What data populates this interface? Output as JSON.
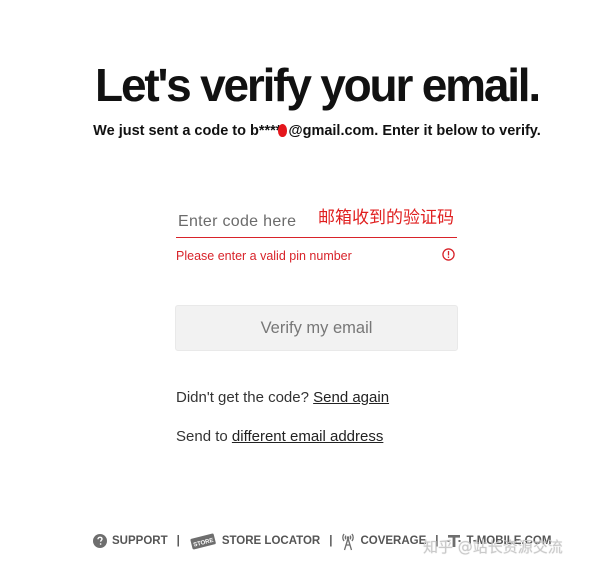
{
  "header": {
    "title": "Let's verify your email.",
    "subtitle_before": "We just sent a code to b****",
    "subtitle_after": "@gmail.com. Enter it below to verify."
  },
  "code_input": {
    "placeholder": "Enter code here",
    "value": "",
    "annotation": "邮箱收到的验证码"
  },
  "error": {
    "message": "Please enter a valid pin number",
    "icon": "exclamation-circle-icon",
    "color": "#d8232a"
  },
  "verify_button": {
    "label": "Verify my email"
  },
  "resend": {
    "prompt": "Didn't get the code?",
    "link": "Send again"
  },
  "change_email": {
    "prompt": "Send to",
    "link": "different email address"
  },
  "footer": {
    "items": [
      {
        "label": "SUPPORT",
        "icon": "question-circle-icon"
      },
      {
        "label": "STORE LOCATOR",
        "icon": "store-icon",
        "badge": "STORE"
      },
      {
        "label": "COVERAGE",
        "icon": "signal-tower-icon"
      },
      {
        "label": "T-MOBILE.COM",
        "icon": "t-mobile-logo-icon"
      }
    ],
    "separator": "|"
  },
  "watermark": "知乎 @站长资源交流"
}
